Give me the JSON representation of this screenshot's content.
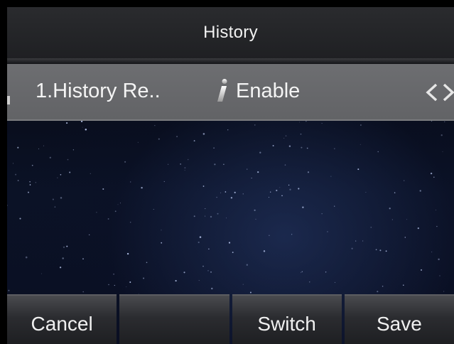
{
  "header": {
    "title": "History"
  },
  "setting_row": {
    "label": "1.History Re..",
    "value": "Enable",
    "info_icon": "info-icon",
    "arrows_icon": "left-right-arrows-icon"
  },
  "softkeys": [
    {
      "label": "Cancel"
    },
    {
      "label": ""
    },
    {
      "label": "Switch"
    },
    {
      "label": "Save"
    }
  ],
  "colors": {
    "title_bar": "#232427",
    "row_bg": "#676869",
    "softkey_bg": "#2b2c30",
    "text": "#f2f2f2"
  }
}
